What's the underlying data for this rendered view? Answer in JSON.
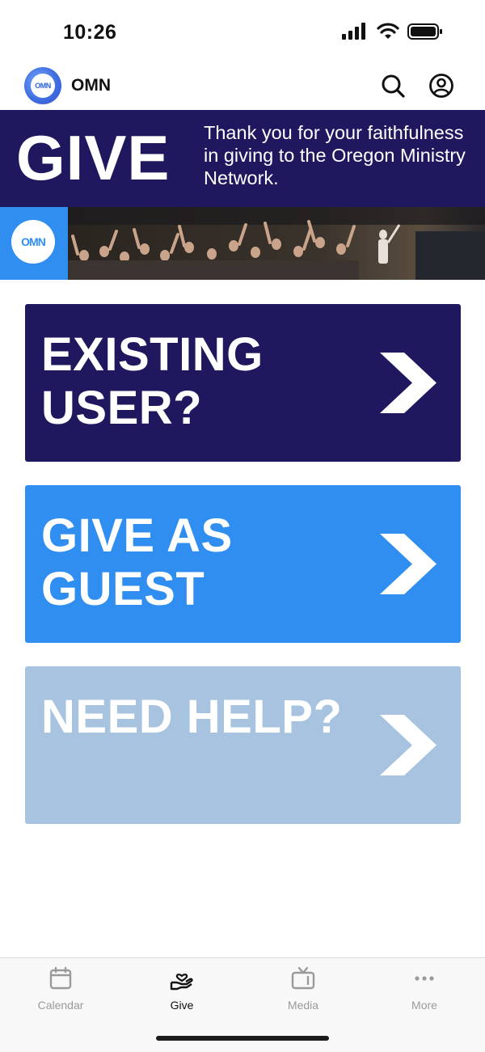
{
  "status_bar": {
    "time": "10:26"
  },
  "header": {
    "app_title": "OMN",
    "logo_text": "OMN"
  },
  "banner": {
    "title": "GIVE",
    "text": "Thank you for your faithfulness in giving to the Oregon Ministry Network.",
    "strip_logo_text": "OMN"
  },
  "cards": [
    {
      "label": "EXISTING USER?",
      "color": "#1f185e"
    },
    {
      "label": "GIVE AS GUEST",
      "color": "#2f8ef0"
    },
    {
      "label": "NEED HELP?",
      "color": "#a7c3e0"
    }
  ],
  "tabs": [
    {
      "label": "Calendar",
      "icon": "calendar-icon",
      "active": false
    },
    {
      "label": "Give",
      "icon": "give-hand-heart-icon",
      "active": true
    },
    {
      "label": "Media",
      "icon": "tv-icon",
      "active": false
    },
    {
      "label": "More",
      "icon": "more-dots-icon",
      "active": false
    }
  ],
  "colors": {
    "banner_bg": "#1f185e",
    "accent_blue": "#2f8ef0",
    "muted_blue": "#a7c3e0"
  }
}
